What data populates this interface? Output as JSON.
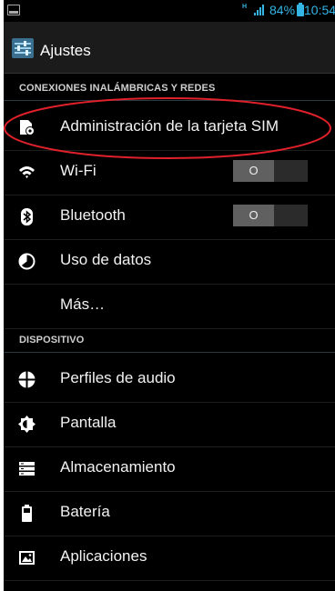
{
  "status_bar": {
    "network": "H",
    "battery_percent": "84%",
    "time": "10:54"
  },
  "header": {
    "title": "Ajustes"
  },
  "sections": [
    {
      "title": "CONEXIONES INALÁMBRICAS Y REDES",
      "items": [
        {
          "label": "Administración de la tarjeta SIM",
          "icon": "sim-card-icon"
        },
        {
          "label": "Wi-Fi",
          "icon": "wifi-icon",
          "toggle": "O"
        },
        {
          "label": "Bluetooth",
          "icon": "bluetooth-icon",
          "toggle": "O"
        },
        {
          "label": "Uso de datos",
          "icon": "data-usage-icon"
        },
        {
          "label": "Más…"
        }
      ]
    },
    {
      "title": "DISPOSITIVO",
      "items": [
        {
          "label": "Perfiles de audio",
          "icon": "audio-profiles-icon"
        },
        {
          "label": "Pantalla",
          "icon": "display-icon"
        },
        {
          "label": "Almacenamiento",
          "icon": "storage-icon"
        },
        {
          "label": "Batería",
          "icon": "battery-icon"
        },
        {
          "label": "Aplicaciones",
          "icon": "apps-icon"
        }
      ]
    }
  ],
  "colors": {
    "accent": "#33b5e5",
    "highlight": "#e0202a",
    "background": "#000000"
  }
}
